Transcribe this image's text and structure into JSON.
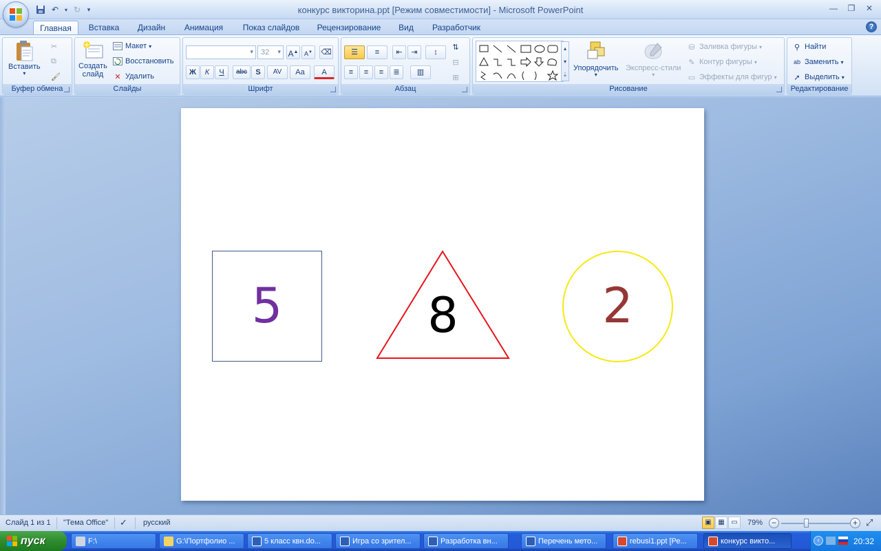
{
  "window": {
    "title": "конкурс викторина.ppt [Режим совместимости] - Microsoft PowerPoint"
  },
  "tabs": [
    "Главная",
    "Вставка",
    "Дизайн",
    "Анимация",
    "Показ слайдов",
    "Рецензирование",
    "Вид",
    "Разработчик"
  ],
  "ribbon": {
    "clipboard": {
      "label": "Буфер обмена",
      "paste": "Вставить"
    },
    "slides": {
      "label": "Слайды",
      "new_slide_line1": "Создать",
      "new_slide_line2": "слайд",
      "layout": "Макет",
      "reset": "Восстановить",
      "delete": "Удалить"
    },
    "font": {
      "label": "Шрифт",
      "font_name": "",
      "font_size": "32",
      "bold": "Ж",
      "italic": "К",
      "underline": "Ч",
      "strike": "abc",
      "shadow": "S",
      "spacing": "AV",
      "case": "Aa",
      "color": "A",
      "grow": "A",
      "shrink": "A"
    },
    "paragraph": {
      "label": "Абзац"
    },
    "drawing": {
      "label": "Рисование",
      "arrange": "Упорядочить",
      "quick_styles": "Экспресс-стили",
      "fill": "Заливка фигуры",
      "outline": "Контур фигуры",
      "effects": "Эффекты для фигур"
    },
    "editing": {
      "label": "Редактирование",
      "find": "Найти",
      "replace": "Заменить",
      "select": "Выделить"
    }
  },
  "slide": {
    "square_number": "5",
    "triangle_number": "8",
    "circle_number": "2",
    "colors": {
      "square_border": "#3f5a8a",
      "square_text": "#7030a0",
      "triangle_border": "#e8141b",
      "triangle_text": "#000000",
      "circle_border": "#f5ea14",
      "circle_text": "#953735"
    }
  },
  "statusbar": {
    "slide_info": "Слайд 1 из 1",
    "theme": "\"Тема Office\"",
    "language": "русский",
    "zoom": "79%"
  },
  "taskbar": {
    "start": "пуск",
    "tasks": [
      {
        "label": "F:\\"
      },
      {
        "label": "G:\\Портфолио ..."
      },
      {
        "label": "5 класс квн.do..."
      },
      {
        "label": "Игра со зрител..."
      },
      {
        "label": "Разработка вн..."
      },
      {
        "label": "Перечень мето..."
      },
      {
        "label": "rebusi1.ppt [Ре..."
      },
      {
        "label": "конкурс викто..."
      }
    ],
    "clock": "20:32"
  }
}
